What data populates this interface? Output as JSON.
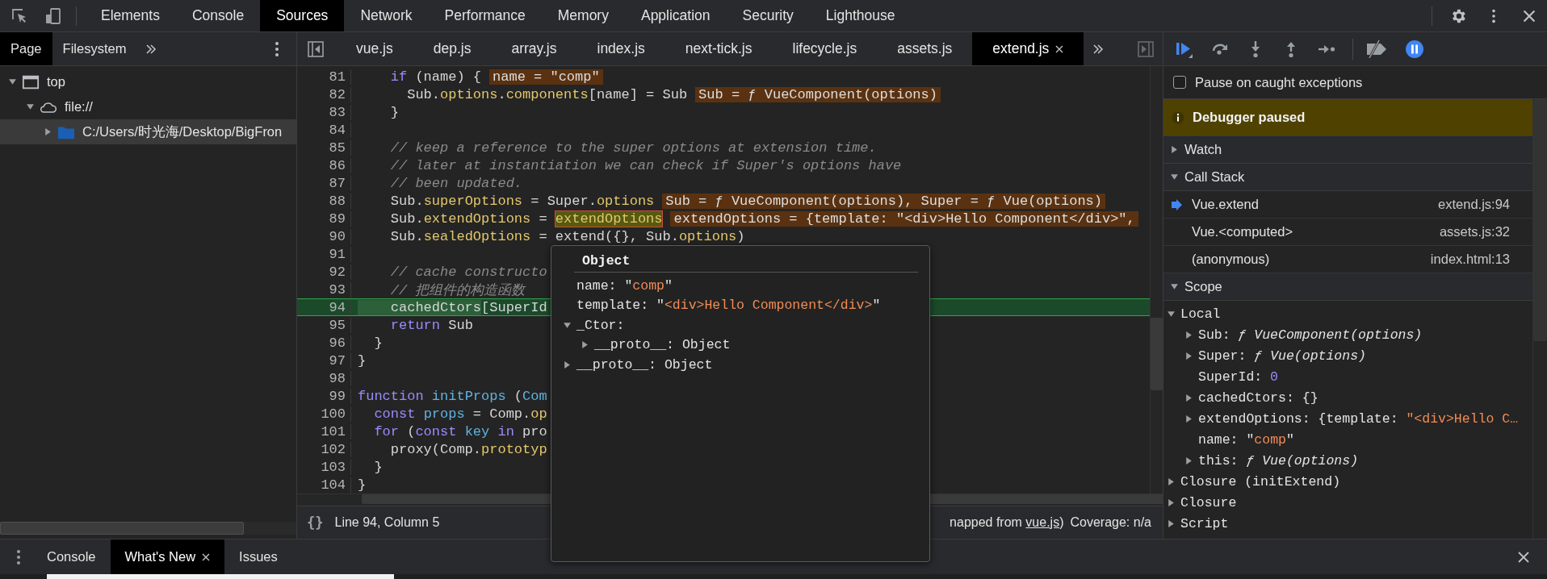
{
  "top_tabs": [
    {
      "label": "Elements",
      "selected": false
    },
    {
      "label": "Console",
      "selected": false
    },
    {
      "label": "Sources",
      "selected": true
    },
    {
      "label": "Network",
      "selected": false
    },
    {
      "label": "Performance",
      "selected": false
    },
    {
      "label": "Memory",
      "selected": false
    },
    {
      "label": "Application",
      "selected": false
    },
    {
      "label": "Security",
      "selected": false
    },
    {
      "label": "Lighthouse",
      "selected": false
    }
  ],
  "navigator": {
    "tabs": [
      {
        "label": "Page",
        "selected": true
      },
      {
        "label": "Filesystem",
        "selected": false
      }
    ],
    "tree": [
      {
        "label": "top",
        "kind": "frame",
        "expanded": true,
        "selected": false,
        "children": [
          {
            "label": "file://",
            "kind": "domain",
            "expanded": true,
            "selected": false,
            "children": [
              {
                "label": "C:/Users/时光海/Desktop/BigFron",
                "kind": "folder",
                "expanded": false,
                "selected": true
              }
            ]
          }
        ]
      }
    ]
  },
  "editor": {
    "tabs": [
      {
        "label": "vue.js",
        "selected": false
      },
      {
        "label": "dep.js",
        "selected": false
      },
      {
        "label": "array.js",
        "selected": false
      },
      {
        "label": "index.js",
        "selected": false
      },
      {
        "label": "next-tick.js",
        "selected": false
      },
      {
        "label": "lifecycle.js",
        "selected": false
      },
      {
        "label": "assets.js",
        "selected": false
      },
      {
        "label": "extend.js",
        "selected": true
      }
    ],
    "lines": [
      {
        "number": "81",
        "current": false,
        "tokens": [
          {
            "text": "    if",
            "kind": "kw"
          },
          {
            "text": " (name) {",
            "kind": "plain"
          }
        ],
        "value": "name = \"comp\""
      },
      {
        "number": "82",
        "current": false,
        "tokens": [
          {
            "text": "      Sub.",
            "kind": "plain"
          },
          {
            "text": "options",
            "kind": "prop"
          },
          {
            "text": ".",
            "kind": "plain"
          },
          {
            "text": "components",
            "kind": "prop"
          },
          {
            "text": "[name] = Sub",
            "kind": "plain"
          }
        ],
        "value": "Sub = ƒ VueComponent(options)"
      },
      {
        "number": "83",
        "current": false,
        "tokens": [
          {
            "text": "    }",
            "kind": "plain"
          }
        ]
      },
      {
        "number": "84",
        "current": false
      },
      {
        "number": "85",
        "current": false,
        "tokens": [
          {
            "text": "    // keep a reference to the super options at extension time.",
            "kind": "comment"
          }
        ]
      },
      {
        "number": "86",
        "current": false,
        "tokens": [
          {
            "text": "    // later at instantiation we can check if Super's options have",
            "kind": "comment"
          }
        ]
      },
      {
        "number": "87",
        "current": false,
        "tokens": [
          {
            "text": "    // been updated.",
            "kind": "comment"
          }
        ]
      },
      {
        "number": "88",
        "current": false,
        "tokens": [
          {
            "text": "    Sub.",
            "kind": "plain"
          },
          {
            "text": "superOptions",
            "kind": "prop"
          },
          {
            "text": " = Super.",
            "kind": "plain"
          },
          {
            "text": "options",
            "kind": "prop"
          }
        ],
        "value": "Sub = ƒ VueComponent(options), Super = ƒ Vue(options)"
      },
      {
        "number": "89",
        "current": false,
        "tokens": [
          {
            "text": "    Sub.",
            "kind": "plain"
          },
          {
            "text": "extendOptions",
            "kind": "prop"
          },
          {
            "text": " = ",
            "kind": "plain"
          },
          {
            "text": "extendOptions",
            "kind": "hover"
          }
        ],
        "value": "extendOptions = {template: \"<div>Hello Component</div>\","
      },
      {
        "number": "90",
        "current": false,
        "tokens": [
          {
            "text": "    Sub.",
            "kind": "plain"
          },
          {
            "text": "sealedOptions",
            "kind": "prop"
          },
          {
            "text": " = extend({}, Sub.",
            "kind": "plain"
          },
          {
            "text": "options",
            "kind": "prop"
          },
          {
            "text": ")",
            "kind": "plain"
          }
        ]
      },
      {
        "number": "91",
        "current": false
      },
      {
        "number": "92",
        "current": false,
        "tokens": [
          {
            "text": "    // cache constructo",
            "kind": "comment"
          }
        ]
      },
      {
        "number": "93",
        "current": false,
        "tokens": [
          {
            "text": "    // 把组件的构造函数",
            "kind": "comment"
          }
        ]
      },
      {
        "number": "94",
        "current": true,
        "tokens": [
          {
            "text": "    cachedCtors",
            "kind": "exec"
          },
          {
            "text": "[SuperId",
            "kind": "plain"
          }
        ]
      },
      {
        "number": "95",
        "current": false,
        "tokens": [
          {
            "text": "    return",
            "kind": "kw"
          },
          {
            "text": " Sub",
            "kind": "plain"
          }
        ]
      },
      {
        "number": "96",
        "current": false,
        "tokens": [
          {
            "text": "  }",
            "kind": "plain"
          }
        ]
      },
      {
        "number": "97",
        "current": false,
        "tokens": [
          {
            "text": "}",
            "kind": "plain"
          }
        ]
      },
      {
        "number": "98",
        "current": false
      },
      {
        "number": "99",
        "current": false,
        "tokens": [
          {
            "text": "function ",
            "kind": "kw"
          },
          {
            "text": "initProps",
            "kind": "def"
          },
          {
            "text": " (",
            "kind": "plain"
          },
          {
            "text": "Com",
            "kind": "def"
          }
        ]
      },
      {
        "number": "100",
        "current": false,
        "tokens": [
          {
            "text": "  const ",
            "kind": "kw"
          },
          {
            "text": "props",
            "kind": "def"
          },
          {
            "text": " = Comp.",
            "kind": "plain"
          },
          {
            "text": "op",
            "kind": "prop"
          }
        ]
      },
      {
        "number": "101",
        "current": false,
        "tokens": [
          {
            "text": "  for",
            "kind": "kw"
          },
          {
            "text": " (",
            "kind": "plain"
          },
          {
            "text": "const ",
            "kind": "kw"
          },
          {
            "text": "key ",
            "kind": "def"
          },
          {
            "text": "in",
            "kind": "kw"
          },
          {
            "text": " pro",
            "kind": "plain"
          }
        ]
      },
      {
        "number": "102",
        "current": false,
        "tokens": [
          {
            "text": "    proxy(Comp.",
            "kind": "plain"
          },
          {
            "text": "prototyp",
            "kind": "prop"
          }
        ]
      },
      {
        "number": "103",
        "current": false,
        "tokens": [
          {
            "text": "  }",
            "kind": "plain"
          }
        ]
      },
      {
        "number": "104",
        "current": false,
        "tokens": [
          {
            "text": "}",
            "kind": "plain"
          }
        ]
      }
    ]
  },
  "status": {
    "format_button": "{}",
    "position": "Line 94, Column 5",
    "source_prefix": "napped from",
    "source_link": "vue.js",
    "source_suffix": ")",
    "coverage": "Coverage: n/a"
  },
  "popup": {
    "title": "Object",
    "properties": [
      {
        "key": "name:",
        "kind": "primitive",
        "value": [
          {
            "text": " \"",
            "kind": "plain"
          },
          {
            "text": "comp",
            "kind": "str"
          },
          {
            "text": "\"",
            "kind": "plain"
          }
        ]
      },
      {
        "key": "template:",
        "kind": "primitive",
        "value": [
          {
            "text": " \"",
            "kind": "plain"
          },
          {
            "text": "<div>Hello Component</div>",
            "kind": "str"
          },
          {
            "text": "\"",
            "kind": "plain"
          }
        ]
      },
      {
        "key": "_Ctor:",
        "kind": "object",
        "expanded": true,
        "children": [
          {
            "key": "__proto__:",
            "kind": "object",
            "expanded": false,
            "value": [
              {
                "text": " Object",
                "kind": "plain"
              }
            ]
          }
        ]
      },
      {
        "key": "__proto__:",
        "kind": "object",
        "expanded": false,
        "value": [
          {
            "text": " Object",
            "kind": "plain"
          }
        ]
      }
    ]
  },
  "debugger": {
    "pause_on_caught": {
      "label": "Pause on caught exceptions",
      "checked": false
    },
    "banner": "Debugger paused",
    "sections": [
      {
        "title": "Watch",
        "expanded": false
      },
      {
        "title": "Call Stack",
        "expanded": true,
        "frames": [
          {
            "name": "Vue.extend",
            "location": "extend.js:94",
            "selected": true
          },
          {
            "name": "Vue.<computed>",
            "location": "assets.js:32",
            "selected": false
          },
          {
            "name": "(anonymous)",
            "location": "index.html:13",
            "selected": false
          }
        ]
      },
      {
        "title": "Scope",
        "expanded": true,
        "scopes": [
          {
            "label": "Local",
            "kind": "object",
            "expanded": true,
            "children": [
              {
                "key": "Sub:",
                "kind": "object",
                "expanded": false,
                "value": [
                  {
                    "text": " ƒ VueComponent(options)",
                    "kind": "fn"
                  }
                ]
              },
              {
                "key": "Super:",
                "kind": "object",
                "expanded": false,
                "value": [
                  {
                    "text": " ƒ Vue(options)",
                    "kind": "fn"
                  }
                ]
              },
              {
                "key": "SuperId:",
                "kind": "primitive",
                "value": [
                  {
                    "text": " 0",
                    "kind": "num"
                  }
                ]
              },
              {
                "key": "cachedCtors:",
                "kind": "object",
                "expanded": false,
                "value": [
                  {
                    "text": " {}",
                    "kind": "plain"
                  }
                ]
              },
              {
                "key": "extendOptions:",
                "kind": "object",
                "expanded": false,
                "value": [
                  {
                    "text": " {template: ",
                    "kind": "plain"
                  },
                  {
                    "text": "\"<div>Hello C…",
                    "kind": "str"
                  }
                ]
              },
              {
                "key": "name:",
                "kind": "primitive",
                "value": [
                  {
                    "text": " \"",
                    "kind": "plain"
                  },
                  {
                    "text": "comp",
                    "kind": "str"
                  },
                  {
                    "text": "\"",
                    "kind": "plain"
                  }
                ]
              },
              {
                "key": "this:",
                "kind": "object",
                "expanded": false,
                "value": [
                  {
                    "text": " ƒ Vue(options)",
                    "kind": "fn"
                  }
                ]
              }
            ]
          },
          {
            "label": "Closure (initExtend)",
            "kind": "object",
            "expanded": false
          },
          {
            "label": "Closure",
            "kind": "object",
            "expanded": false
          },
          {
            "label": "Script",
            "kind": "object",
            "expanded": false
          }
        ]
      }
    ]
  },
  "drawer": {
    "tabs": [
      {
        "label": "Console",
        "selected": false
      },
      {
        "label": "What's New",
        "selected": true
      },
      {
        "label": "Issues",
        "selected": false
      }
    ]
  }
}
